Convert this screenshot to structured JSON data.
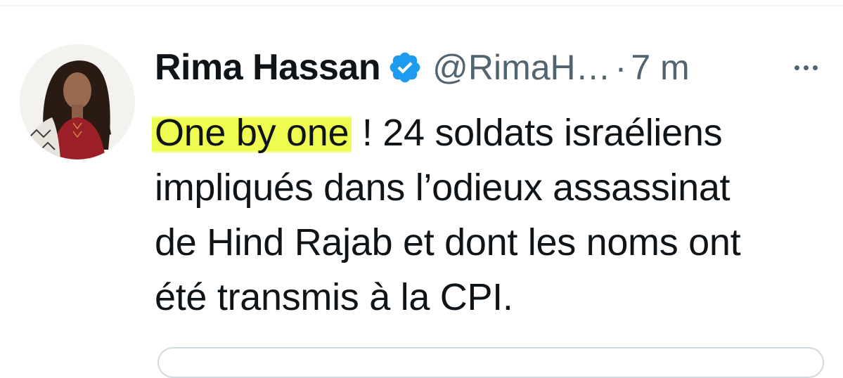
{
  "tweet": {
    "author": {
      "display_name": "Rima Hassan",
      "handle": "@RimaH…",
      "verified_icon": "verified-badge-icon"
    },
    "separator": "·",
    "timestamp": "7 m",
    "more_icon": "more-options-icon",
    "text": {
      "highlighted": "One by one",
      "line1_rest": " ! 24 soldats israéliens",
      "line2": "impliqués dans l’odieux assassinat",
      "line3": "de Hind Rajab et dont les noms ont",
      "line4": "été transmis à la CPI."
    }
  },
  "colors": {
    "text_primary": "#0f1419",
    "text_secondary": "#536471",
    "verified_blue": "#1d9bf0",
    "highlight": "#eefc46",
    "border": "#cfd9de"
  }
}
